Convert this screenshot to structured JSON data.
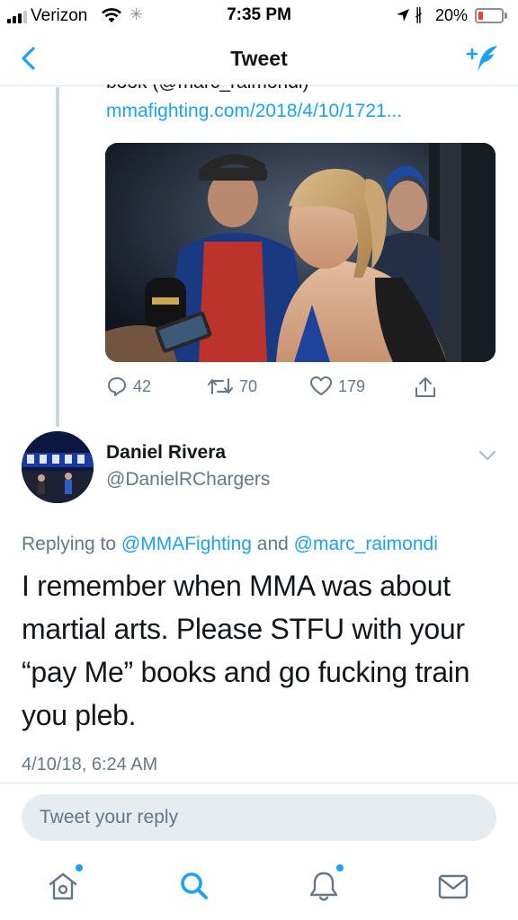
{
  "status_bar": {
    "carrier": "Verizon",
    "time": "7:35 PM",
    "battery_percent": "20%",
    "battery_level": 0.2,
    "icons": [
      "signal-icon",
      "wifi-icon",
      "activity-icon",
      "location-icon",
      "bluetooth-icon",
      "battery-icon"
    ]
  },
  "nav": {
    "title": "Tweet",
    "back_icon": "chevron-left-icon",
    "compose_icon": "compose-tweet-icon"
  },
  "parent_tweet": {
    "cut_off_text": "book (@marc_raimondi)",
    "link": "mmafighting.com/2018/4/10/1721...",
    "media_alt": "photo",
    "actions": {
      "replies": "42",
      "retweets": "70",
      "likes": "179"
    }
  },
  "reply": {
    "name": "Daniel Rivera",
    "handle": "@DanielRChargers",
    "replying_prefix": "Replying to",
    "mention_1": "@MMAFighting",
    "conjunction": "and",
    "mention_2": "@marc_raimondi",
    "text": "I remember when MMA was about martial arts. Please STFU with your “pay Me” books and go fucking train you pleb.",
    "timestamp": "4/10/18, 6:24 AM"
  },
  "composer": {
    "placeholder": "Tweet your reply"
  },
  "tabbar": {
    "items": [
      {
        "name": "home",
        "icon": "home-icon",
        "has_dot": true
      },
      {
        "name": "search",
        "icon": "search-icon",
        "has_dot": false
      },
      {
        "name": "notifications",
        "icon": "bell-icon",
        "has_dot": true
      },
      {
        "name": "messages",
        "icon": "mail-icon",
        "has_dot": false
      }
    ]
  },
  "colors": {
    "accent": "#1da1f2",
    "secondary_text": "#657786",
    "primary_text": "#14171a",
    "battery_low": "#ff3b30"
  }
}
